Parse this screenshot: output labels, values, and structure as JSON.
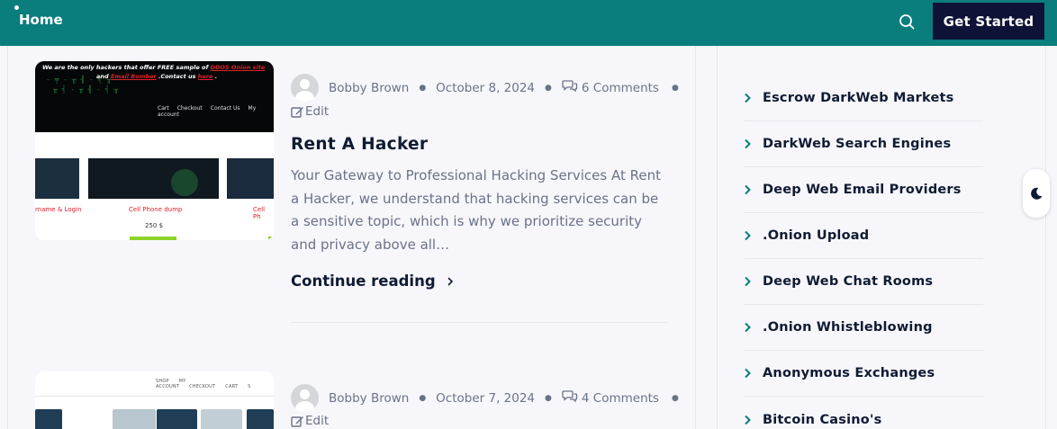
{
  "header": {
    "home_label": "Home",
    "search_icon": "search-icon",
    "cta_label": "Get Started",
    "bg_color": "#0a7d7d",
    "cta_color": "#0d1236"
  },
  "posts": [
    {
      "author": "Bobby Brown",
      "date": "October 8, 2024",
      "comments": "6 Comments",
      "edit_label": "Edit",
      "title": "Rent A Hacker",
      "excerpt": "Your Gateway to Professional Hacking Services At Rent a Hacker, we understand that hacking services can be a sensitive topic, which is why we prioritize security and privacy above all…",
      "continue_label": "Continue reading",
      "thumbnail": {
        "banner_prefix": "We are the only hackers that offer FREE sample of ",
        "banner_link1": "DDOS Onion site",
        "banner_mid": " and ",
        "banner_link2": "Email Bomber",
        "banner_suffix1": " .Contact us ",
        "banner_link3": "here",
        "banner_suffix2": " .",
        "nav": [
          "Cart",
          "Checkout",
          "Contact Us",
          "My account"
        ],
        "captions": [
          "rname & Login",
          "Cell Phone dump",
          "Cell Ph"
        ],
        "price": "250 $"
      }
    },
    {
      "author": "Bobby Brown",
      "date": "October 7, 2024",
      "comments": "4 Comments",
      "edit_label": "Edit",
      "thumbnail": {
        "nav": [
          "SHOP",
          "MY ACCOUNT",
          "CHECKOUT",
          "CART",
          "S"
        ]
      }
    }
  ],
  "sidebar": {
    "items": [
      {
        "label": "Escrow DarkWeb Markets"
      },
      {
        "label": "DarkWeb Search Engines"
      },
      {
        "label": "Deep Web Email Providers"
      },
      {
        "label": ".Onion Upload"
      },
      {
        "label": "Deep Web Chat Rooms"
      },
      {
        "label": ".Onion Whistleblowing"
      },
      {
        "label": "Anonymous Exchanges"
      },
      {
        "label": "Bitcoin Casino's"
      }
    ],
    "chevron_icon": "chevron-right-icon",
    "accent_color": "#0a7d7d"
  },
  "dark_mode_toggle": {
    "icon": "moon-icon"
  }
}
